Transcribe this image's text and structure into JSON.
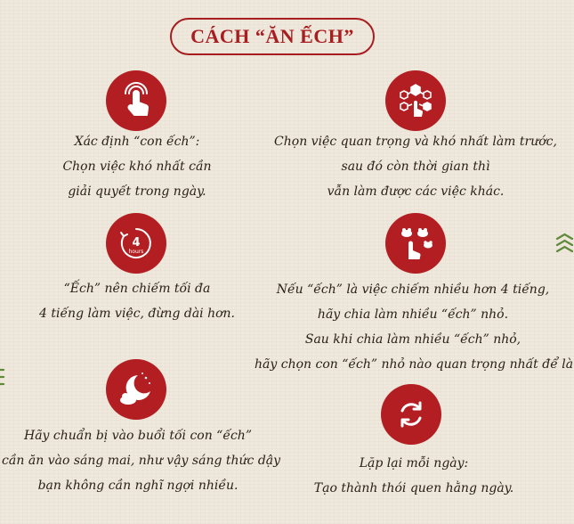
{
  "title": "CÁCH “ĂN ẾCH”",
  "items": [
    {
      "icon": "tap-hand-icon",
      "lines": [
        "Xác định “con ếch”:",
        "Chọn việc khó nhất cần",
        "giải quyết trong ngày."
      ]
    },
    {
      "icon": "network-hand-icon",
      "lines": [
        "Chọn việc quan trọng và khó nhất làm trước,",
        "sau đó còn thời gian thì",
        "vẫn làm được các việc khác."
      ]
    },
    {
      "icon": "clock-4-hours-icon",
      "clock_label": "4",
      "clock_sub": "hours",
      "lines": [
        "“Ếch” nên chiếm tối đa",
        "4 tiếng làm việc, đừng dài hơn."
      ]
    },
    {
      "icon": "frogs-hand-icon",
      "lines": [
        "Nếu “ếch” là việc chiếm nhiều hơn 4 tiếng,",
        "hãy chia làm nhiều “ếch” nhỏ.",
        "Sau khi chia làm nhiều “ếch” nhỏ,",
        "hãy chọn con “ếch” nhỏ nào quan trọng nhất để làm."
      ]
    },
    {
      "icon": "moon-night-icon",
      "lines": [
        "Hãy chuẩn bị vào buổi tối con “ếch”",
        "cần ăn vào sáng mai, như vậy sáng thức dậy",
        "bạn không cần nghĩ ngợi nhiều."
      ]
    },
    {
      "icon": "repeat-arrows-icon",
      "lines": [
        "Lặp lại mỗi ngày:",
        "Tạo thành thói quen hằng ngày."
      ]
    }
  ],
  "colors": {
    "accent": "#b31e22",
    "title": "#a71d20",
    "side_mark": "#5e8a3a",
    "background": "#efe8dc"
  }
}
